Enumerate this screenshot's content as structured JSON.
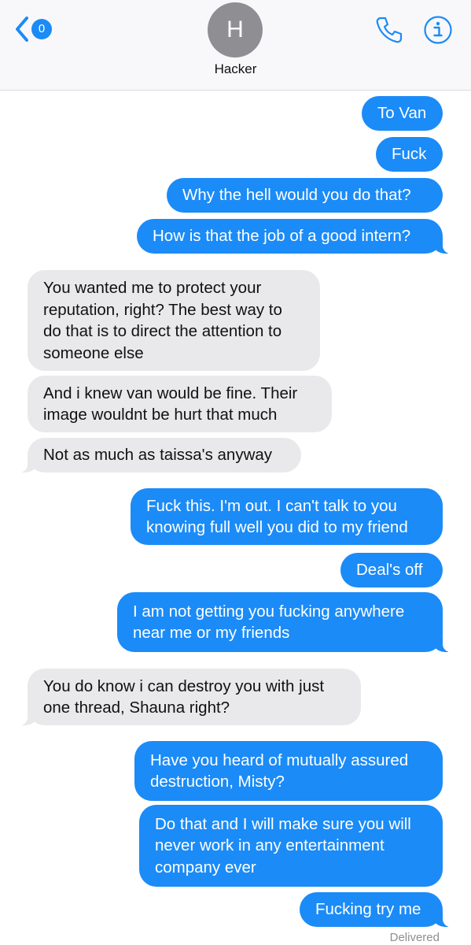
{
  "header": {
    "back_badge_count": "0",
    "avatar_initial": "H",
    "contact_name": "Hacker",
    "icons": {
      "back": "chevron-left-icon",
      "call": "phone-icon",
      "info": "info-icon"
    },
    "accent_color": "#1b8bf7"
  },
  "messages": [
    {
      "from": "me",
      "text": "To Van"
    },
    {
      "from": "me",
      "text": "Fuck"
    },
    {
      "from": "me",
      "text": "Why the hell would you do that?"
    },
    {
      "from": "me",
      "text": "How is that the job of a good intern?"
    },
    {
      "from": "them",
      "text": "You wanted me to protect your reputation, right? The best way to do that is to direct the attention to someone else"
    },
    {
      "from": "them",
      "text": "And i knew van would be fine. Their image wouldnt be hurt that much"
    },
    {
      "from": "them",
      "text": "Not as much as taissa's anyway"
    },
    {
      "from": "me",
      "text": "Fuck this. I'm out. I can't talk to you knowing full well you did to my friend"
    },
    {
      "from": "me",
      "text": "Deal's off"
    },
    {
      "from": "me",
      "text": "I am not getting you fucking anywhere near me or my friends"
    },
    {
      "from": "them",
      "text": "You do know i can destroy you with just one thread, Shauna right?"
    },
    {
      "from": "me",
      "text": "Have you heard of mutually assured destruction, Misty?"
    },
    {
      "from": "me",
      "text": "Do that and I will make sure you will never work in any entertainment company ever"
    },
    {
      "from": "me",
      "text": "Fucking try me"
    }
  ],
  "status": "Delivered"
}
